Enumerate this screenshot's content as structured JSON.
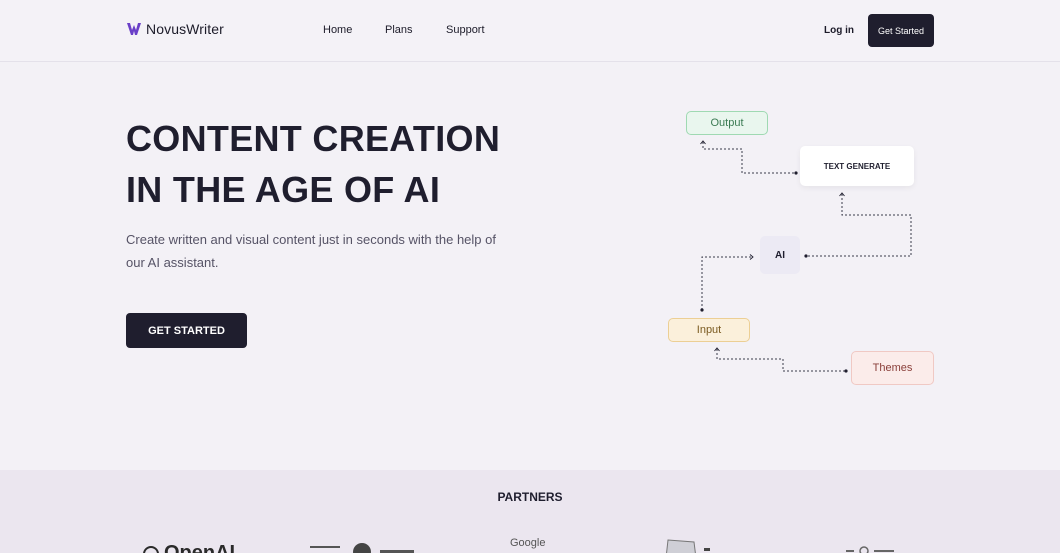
{
  "nav": {
    "brand": "NovusWriter",
    "links": [
      "Home",
      "Plans",
      "Support"
    ],
    "login": "Log in",
    "cta": "Get Started"
  },
  "hero": {
    "title_line1": "CONTENT CREATION",
    "title_line2": "IN THE AGE OF AI",
    "subtitle": "Create written and visual content just in seconds with the help of our AI assistant.",
    "cta": "GET STARTED"
  },
  "diagram": {
    "output": "Output",
    "text_generate": "TEXT GENERATE",
    "ai": "AI",
    "input": "Input",
    "themes": "Themes"
  },
  "partners": {
    "title": "PARTNERS",
    "logos": [
      "OpenAI",
      "Google"
    ]
  },
  "colors": {
    "dark": "#1f1e2e",
    "brand_purple": "#6a3fc8",
    "background": "#f3f1f6",
    "partners_bg": "#ebe6ef"
  }
}
